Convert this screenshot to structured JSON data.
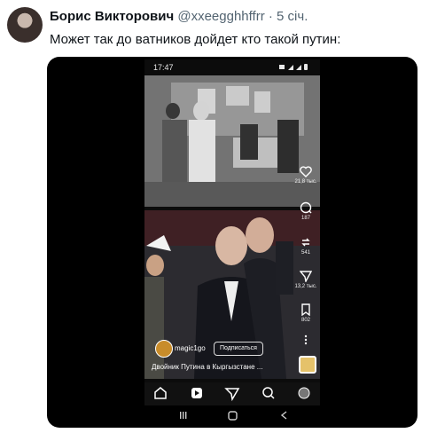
{
  "tweet": {
    "author_name": "Борис Викторович",
    "author_handle": "@xxeegghhffrr",
    "separator": "·",
    "time": "5 січ.",
    "text": "Может так до ватников дойдет кто такой путин:"
  },
  "phone": {
    "status_time": "17:47",
    "rail": {
      "likes": "21,8 тыс.",
      "comments": "187",
      "reposts": "541",
      "shares": "13,2 тыс.",
      "saves": "802"
    },
    "reel_user": "magic1go",
    "subscribe_label": "Подписаться",
    "caption": "Двойник Путина в Кыргызстане ..."
  },
  "icons": {
    "home": "home-icon",
    "reels": "reels-icon",
    "send": "send-icon",
    "search": "search-icon",
    "profile": "profile-icon",
    "recents": "recents-icon",
    "homebtn": "home-button-icon",
    "back": "back-icon"
  }
}
